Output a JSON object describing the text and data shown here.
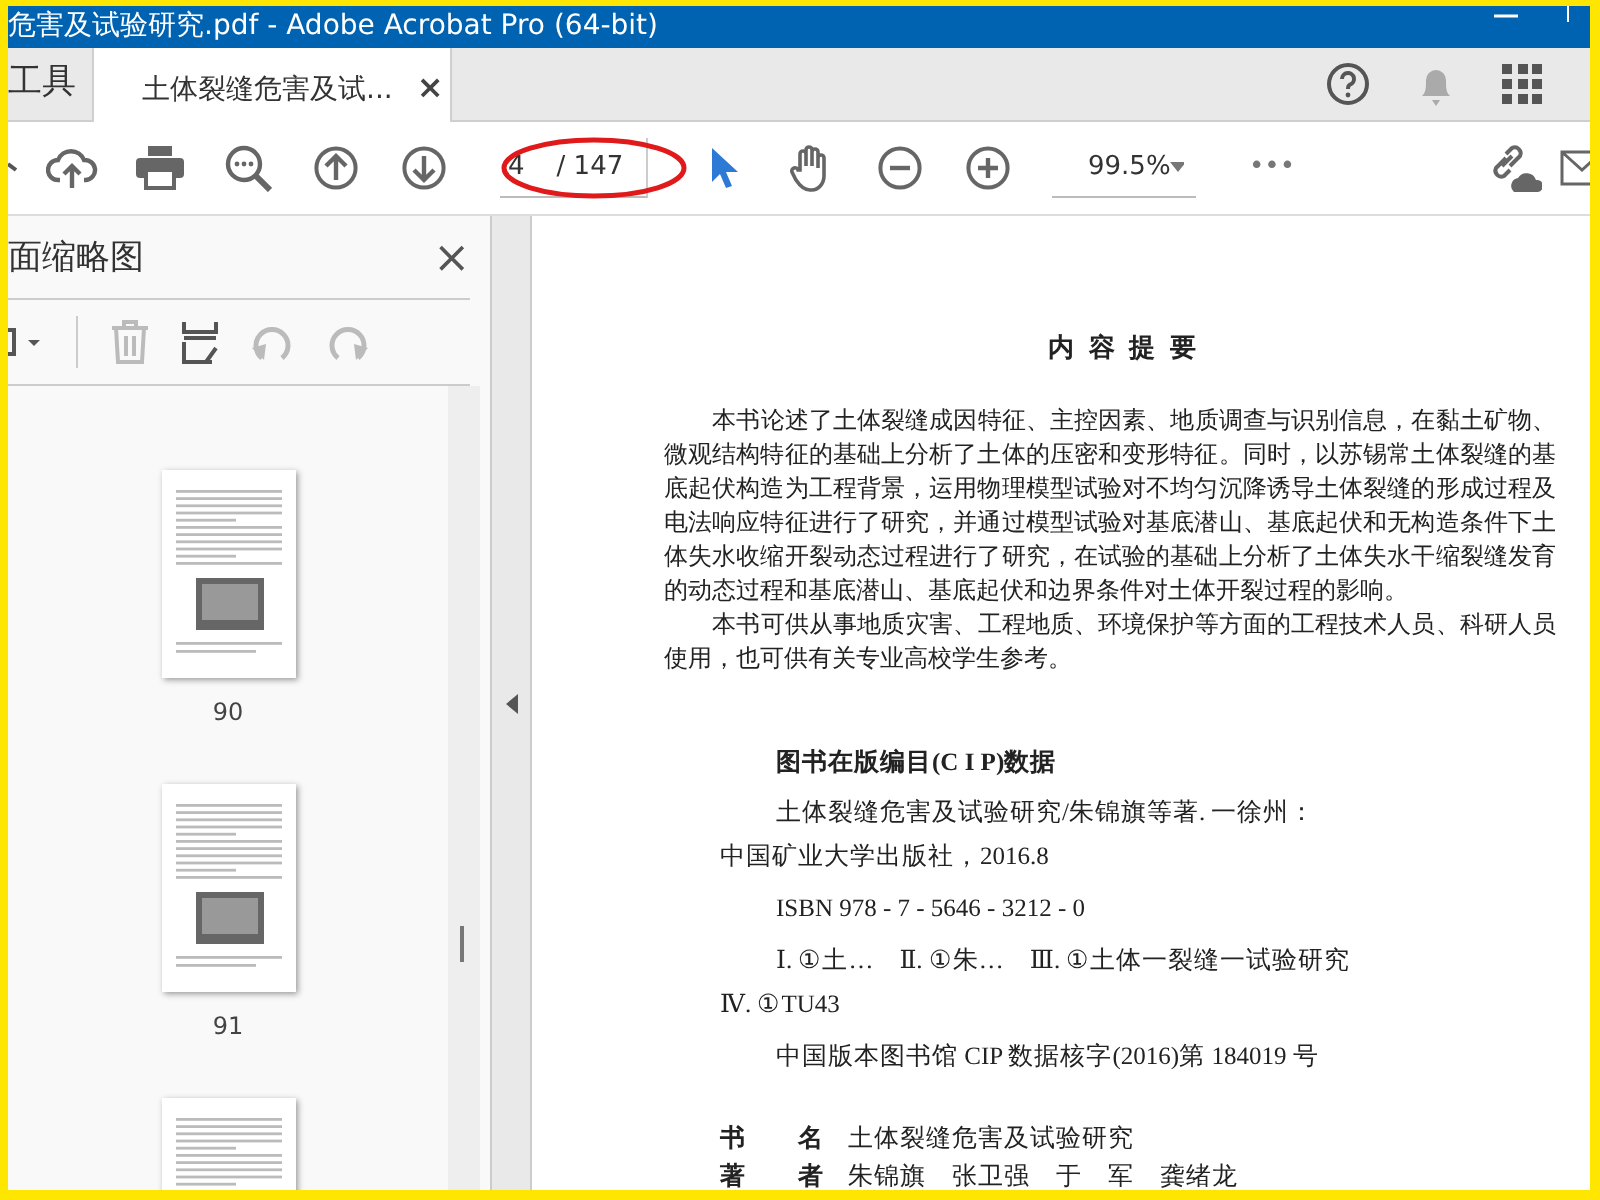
{
  "window": {
    "title": "危害及试验研究.pdf - Adobe Acrobat Pro (64-bit)"
  },
  "tabs": [
    {
      "label": "工具",
      "selected": false,
      "closable": false
    },
    {
      "label": "土体裂缝危害及试...",
      "selected": true,
      "closable": true,
      "close": "×"
    }
  ],
  "toolbar": {
    "page_number": "4",
    "page_count": "/ 147",
    "zoom": "99.5%",
    "more": "•••",
    "tools": [
      {
        "kind": "select",
        "selected": true
      },
      {
        "kind": "hand",
        "selected": false
      }
    ]
  },
  "sidebar": {
    "title": "面缩略图",
    "close": "×",
    "thumbnails": [
      {
        "label": "90",
        "kind": "photo"
      },
      {
        "label": "91",
        "kind": "photo"
      },
      {
        "kind": "text"
      }
    ]
  },
  "document": {
    "heading": "内 容 提 要",
    "paragraphs": [
      "本书论述了土体裂缝成因特征、主控因素、地质调查与识别信息，在黏土矿物、微观结构特征的基础上分析了土体的压密和变形特征。同时，以苏锡常土体裂缝的基底起伏构造为工程背景，运用物理模型试验对不均匀沉降诱导土体裂缝的形成过程及电法响应特征进行了研究，并通过模型试验对基底潜山、基底起伏和无构造条件下土体失水收缩开裂动态过程进行了研究，在试验的基础上分析了土体失水干缩裂缝发育的动态过程和基底潜山、基底起伏和边界条件对土体开裂过程的影响。",
      "本书可供从事地质灾害、工程地质、环境保护等方面的工程技术人员、科研人员使用，也可供有关专业高校学生参考。"
    ],
    "cip_title": "图书在版编目(C I P)数据",
    "cip_entries": [
      {
        "lines": [
          "土体裂缝危害及试验研究/朱锦旗等著. 一徐州：",
          "中国矿业大学出版社，2016.8"
        ]
      },
      {
        "lines": [
          "ISBN 978 - 7 - 5646 - 3212 - 0"
        ]
      },
      {
        "lines": [
          "Ⅰ. ①土…　Ⅱ. ①朱…　Ⅲ. ①土体一裂缝一试验研究",
          "Ⅳ. ①TU43"
        ]
      },
      {
        "lines": [
          "中国版本图书馆 CIP 数据核字(2016)第 184019 号"
        ]
      }
    ],
    "info_rows": [
      {
        "key": "书　　名",
        "value": "土体裂缝危害及试验研究"
      },
      {
        "key": "著　　者",
        "value": "朱锦旗　张卫强　于　军　龚绪龙"
      }
    ]
  }
}
